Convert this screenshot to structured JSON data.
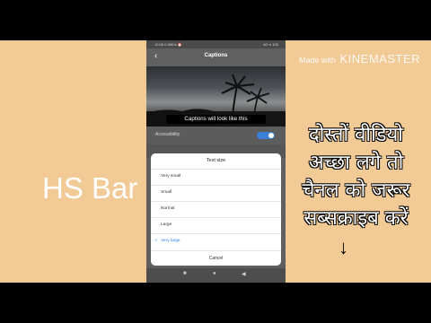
{
  "status_bar": {
    "left": "10:08 0.48K/s ⏰",
    "right": "4G ▪▪ 100"
  },
  "app_bar": {
    "title": "Captions"
  },
  "preview": {
    "caption_text": "Captions will look like this"
  },
  "accessibility": {
    "label": "Accessibility",
    "toggle_on": true
  },
  "dialog": {
    "title": "Text size",
    "options": [
      {
        "label": "Very small",
        "selected": false
      },
      {
        "label": "Small",
        "selected": false
      },
      {
        "label": "Normal",
        "selected": false
      },
      {
        "label": "Large",
        "selected": false
      },
      {
        "label": "Very large",
        "selected": true
      }
    ],
    "cancel_label": "Cancel"
  },
  "nav": {
    "recent": "■",
    "home": "●",
    "back": "◀"
  },
  "overlay": {
    "watermark_prefix": "Made with",
    "watermark_brand": "KINEMASTER",
    "channel_name": "HS Bar",
    "message_lines": [
      "दोस्तों वीडियो",
      "अच्छा लगे तो",
      "चैनल को जरूर",
      "सब्सक्राइब करें"
    ],
    "arrow": "↓"
  },
  "colors": {
    "background": "#f1ca96",
    "accent": "#2f7fe0",
    "toggle": "#3b7fd6"
  }
}
